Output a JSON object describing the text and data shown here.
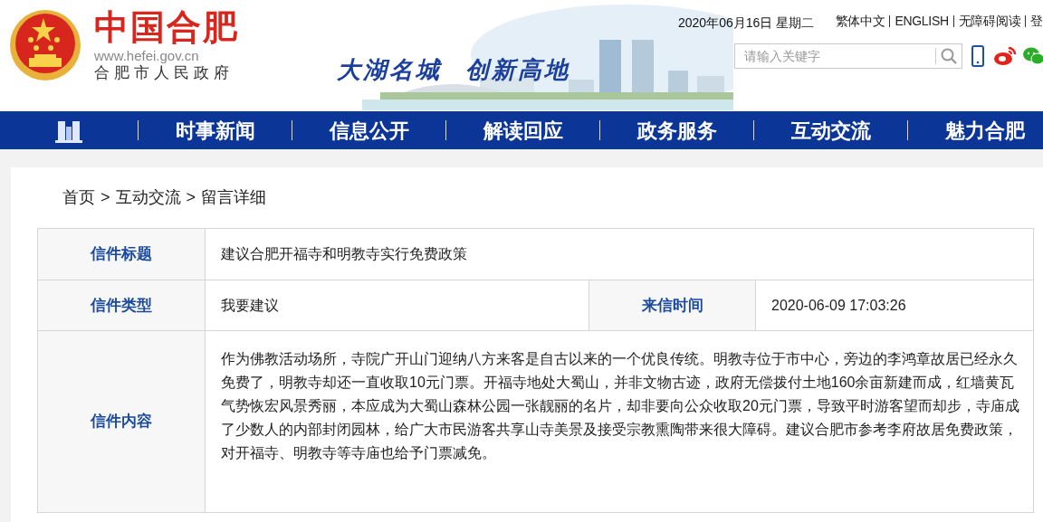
{
  "header": {
    "site_name": "中国合肥",
    "site_url": "www.hefei.gov.cn",
    "site_org": "合肥市人民政府",
    "slogans": [
      "大湖名城",
      "创新高地"
    ],
    "date": "2020年06月16日 星期二",
    "links": [
      "繁体中文",
      "ENGLISH",
      "无障碍阅读",
      "登"
    ],
    "search": {
      "placeholder": "请输入关键字"
    }
  },
  "nav": {
    "items": [
      "时事新闻",
      "信息公开",
      "解读回应",
      "政务服务",
      "互动交流",
      "魅力合肥"
    ]
  },
  "breadcrumb": [
    "首页",
    "互动交流",
    "留言详细"
  ],
  "breadcrumb_separator": ">",
  "letter": {
    "title_label": "信件标题",
    "title": "建议合肥开福寺和明教寺实行免费政策",
    "type_label": "信件类型",
    "type": "我要建议",
    "time_label": "来信时间",
    "time": "2020-06-09 17:03:26",
    "content_label": "信件内容",
    "content": "作为佛教活动场所，寺院广开山门迎纳八方来客是自古以来的一个优良传统。明教寺位于市中心，旁边的李鸿章故居已经永久免费了，明教寺却还一直收取10元门票。开福寺地处大蜀山，并非文物古迹，政府无偿拨付土地160余亩新建而成，红墙黄瓦气势恢宏风景秀丽，本应成为大蜀山森林公园一张靓丽的名片，却非要向公众收取20元门票，导致平时游客望而却步，寺庙成了少数人的内部封闭园林，给广大市民游客共享山寺美景及接受宗教熏陶带来很大障碍。建议合肥市参考李府故居免费政策，对开福寺、明教寺等寺庙也给予门票减免。"
  }
}
